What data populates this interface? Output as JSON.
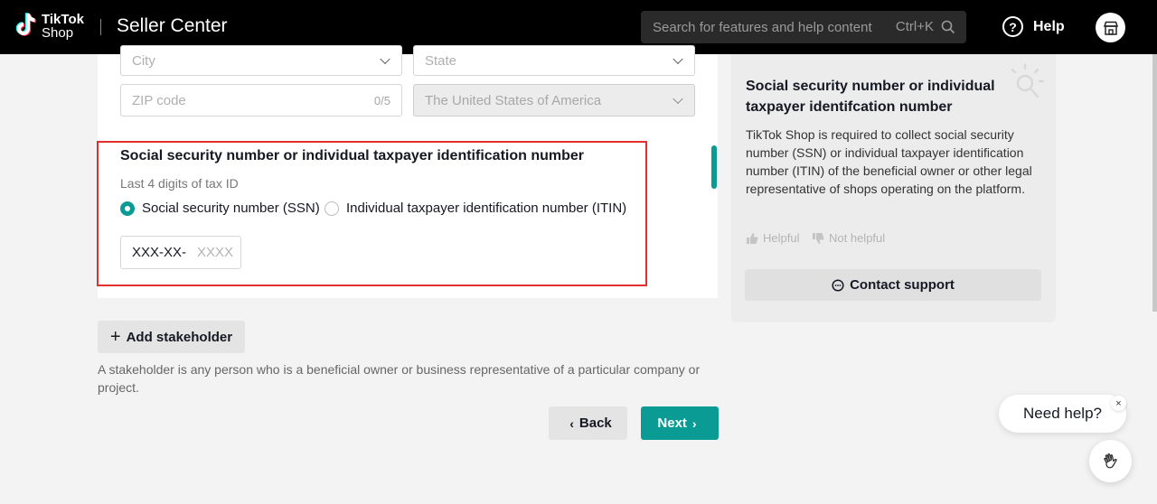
{
  "header": {
    "logo_line1": "TikTok",
    "logo_line2": "Shop",
    "app_title": "Seller Center",
    "search_placeholder": "Search for features and help content",
    "search_shortcut": "Ctrl+K",
    "help_label": "Help"
  },
  "form": {
    "city_placeholder": "City",
    "state_placeholder": "State",
    "zip_placeholder": "ZIP code",
    "zip_counter": "0/5",
    "country_value": "The United States of America",
    "tax": {
      "title": "Social security number or individual taxpayer identification number",
      "subtitle": "Last 4 digits of tax ID",
      "option_ssn": "Social security number (SSN)",
      "option_itin": "Individual taxpayer identification number (ITIN)",
      "selected": "ssn",
      "input_prefix": "XXX-XX-",
      "input_placeholder": "XXXX"
    },
    "add_stakeholder_label": "Add stakeholder",
    "stakeholder_note": "A stakeholder is any person who is a beneficial owner or business representative of a particular company or project.",
    "back_label": "Back",
    "next_label": "Next"
  },
  "help_panel": {
    "title": "Social security number or individual taxpayer identifcation number",
    "body": "TikTok Shop is required to collect social security number (SSN) or individual taxpayer identification number (ITIN) of the beneficial owner or other legal representative of shops operating on the platform.",
    "helpful_label": "Helpful",
    "not_helpful_label": "Not helpful",
    "contact_label": "Contact support"
  },
  "widget": {
    "need_help_label": "Need help?",
    "close_label": "×"
  },
  "colors": {
    "accent": "#0a9c94",
    "highlight_border": "#e32f2f"
  }
}
